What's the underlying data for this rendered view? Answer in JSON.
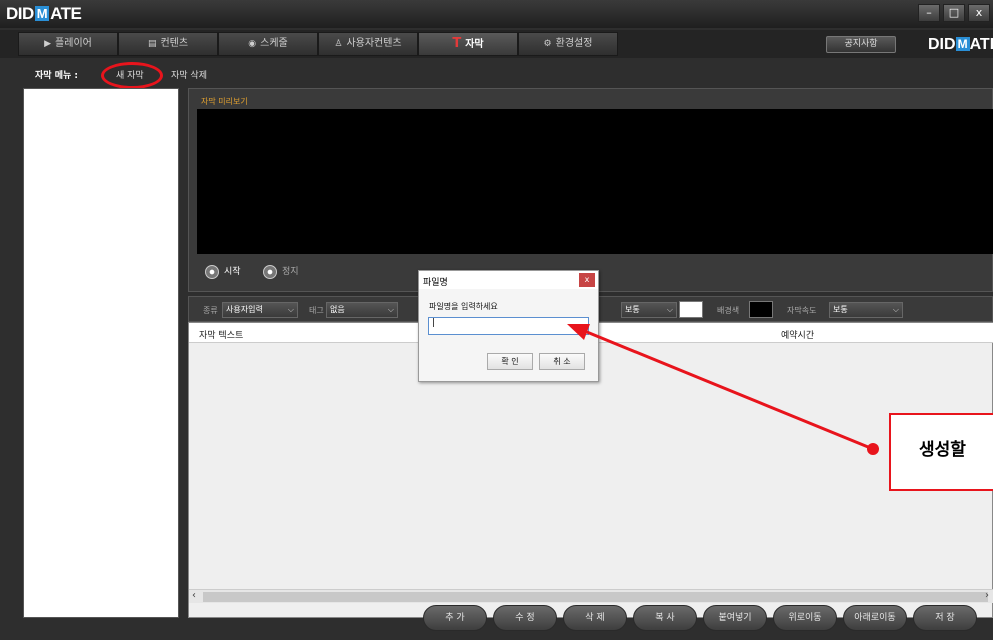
{
  "app": {
    "logo_pre": "DID",
    "logo_mid": "M",
    "logo_post": "ATE",
    "window_buttons": [
      "–",
      "□",
      "x"
    ]
  },
  "tabs": [
    {
      "icon": "▶",
      "label": "플레이어"
    },
    {
      "icon": "▤",
      "label": "컨텐츠"
    },
    {
      "icon": "◉",
      "label": "스케줄"
    },
    {
      "icon": "♙",
      "label": "사용자컨텐츠"
    },
    {
      "icon": "T",
      "label": "자막",
      "active": true
    },
    {
      "icon": "⚙",
      "label": "환경설정"
    }
  ],
  "header": {
    "notice_button": "공지사항",
    "brand_pre": "DID",
    "brand_mid": "M",
    "brand_post": "ATE"
  },
  "submenu": {
    "label": "자막 메뉴 :",
    "new_subtitle": "새 자막",
    "delete_subtitle": "자막 삭제"
  },
  "preview": {
    "title": "자막 미리보기",
    "start_label": "시작",
    "stop_label": "정지"
  },
  "options": {
    "type_label": "종류",
    "type_value": "사용자입력",
    "tag_label": "태그",
    "tag_value": "없음",
    "size_value": "보통",
    "bgcolor_label": "배경색",
    "speed_label": "자막속도",
    "speed_value": "보통",
    "text_color": "#ffffff",
    "bg_color": "#000000"
  },
  "table": {
    "col_text": "자막 텍스트",
    "col_schedule": "예약시간"
  },
  "bottom_buttons": [
    "추 가",
    "수 정",
    "삭 제",
    "복 사",
    "붙여넣기",
    "위로이동",
    "아래로이동",
    "저 장"
  ],
  "dialog": {
    "title": "파일명",
    "close": "x",
    "prompt": "파일명을 입력하세요",
    "input_value": "|",
    "ok": "확 인",
    "cancel": "취 소"
  },
  "annotation": {
    "text": "생성할"
  }
}
